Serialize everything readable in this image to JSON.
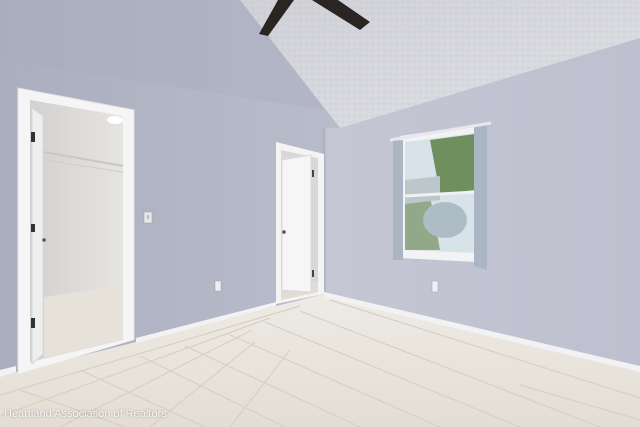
{
  "photo": {
    "watermark": "Heartland Association of Realtors"
  },
  "palette": {
    "left_wall": "#b4b7c6",
    "right_wall": "#c7c8d6",
    "ceiling": "#d6d7dc",
    "floor": "#eae6de",
    "grout": "#d4cfc5",
    "trim": "#f4f4f4",
    "closet_interior": "#dedcda"
  }
}
